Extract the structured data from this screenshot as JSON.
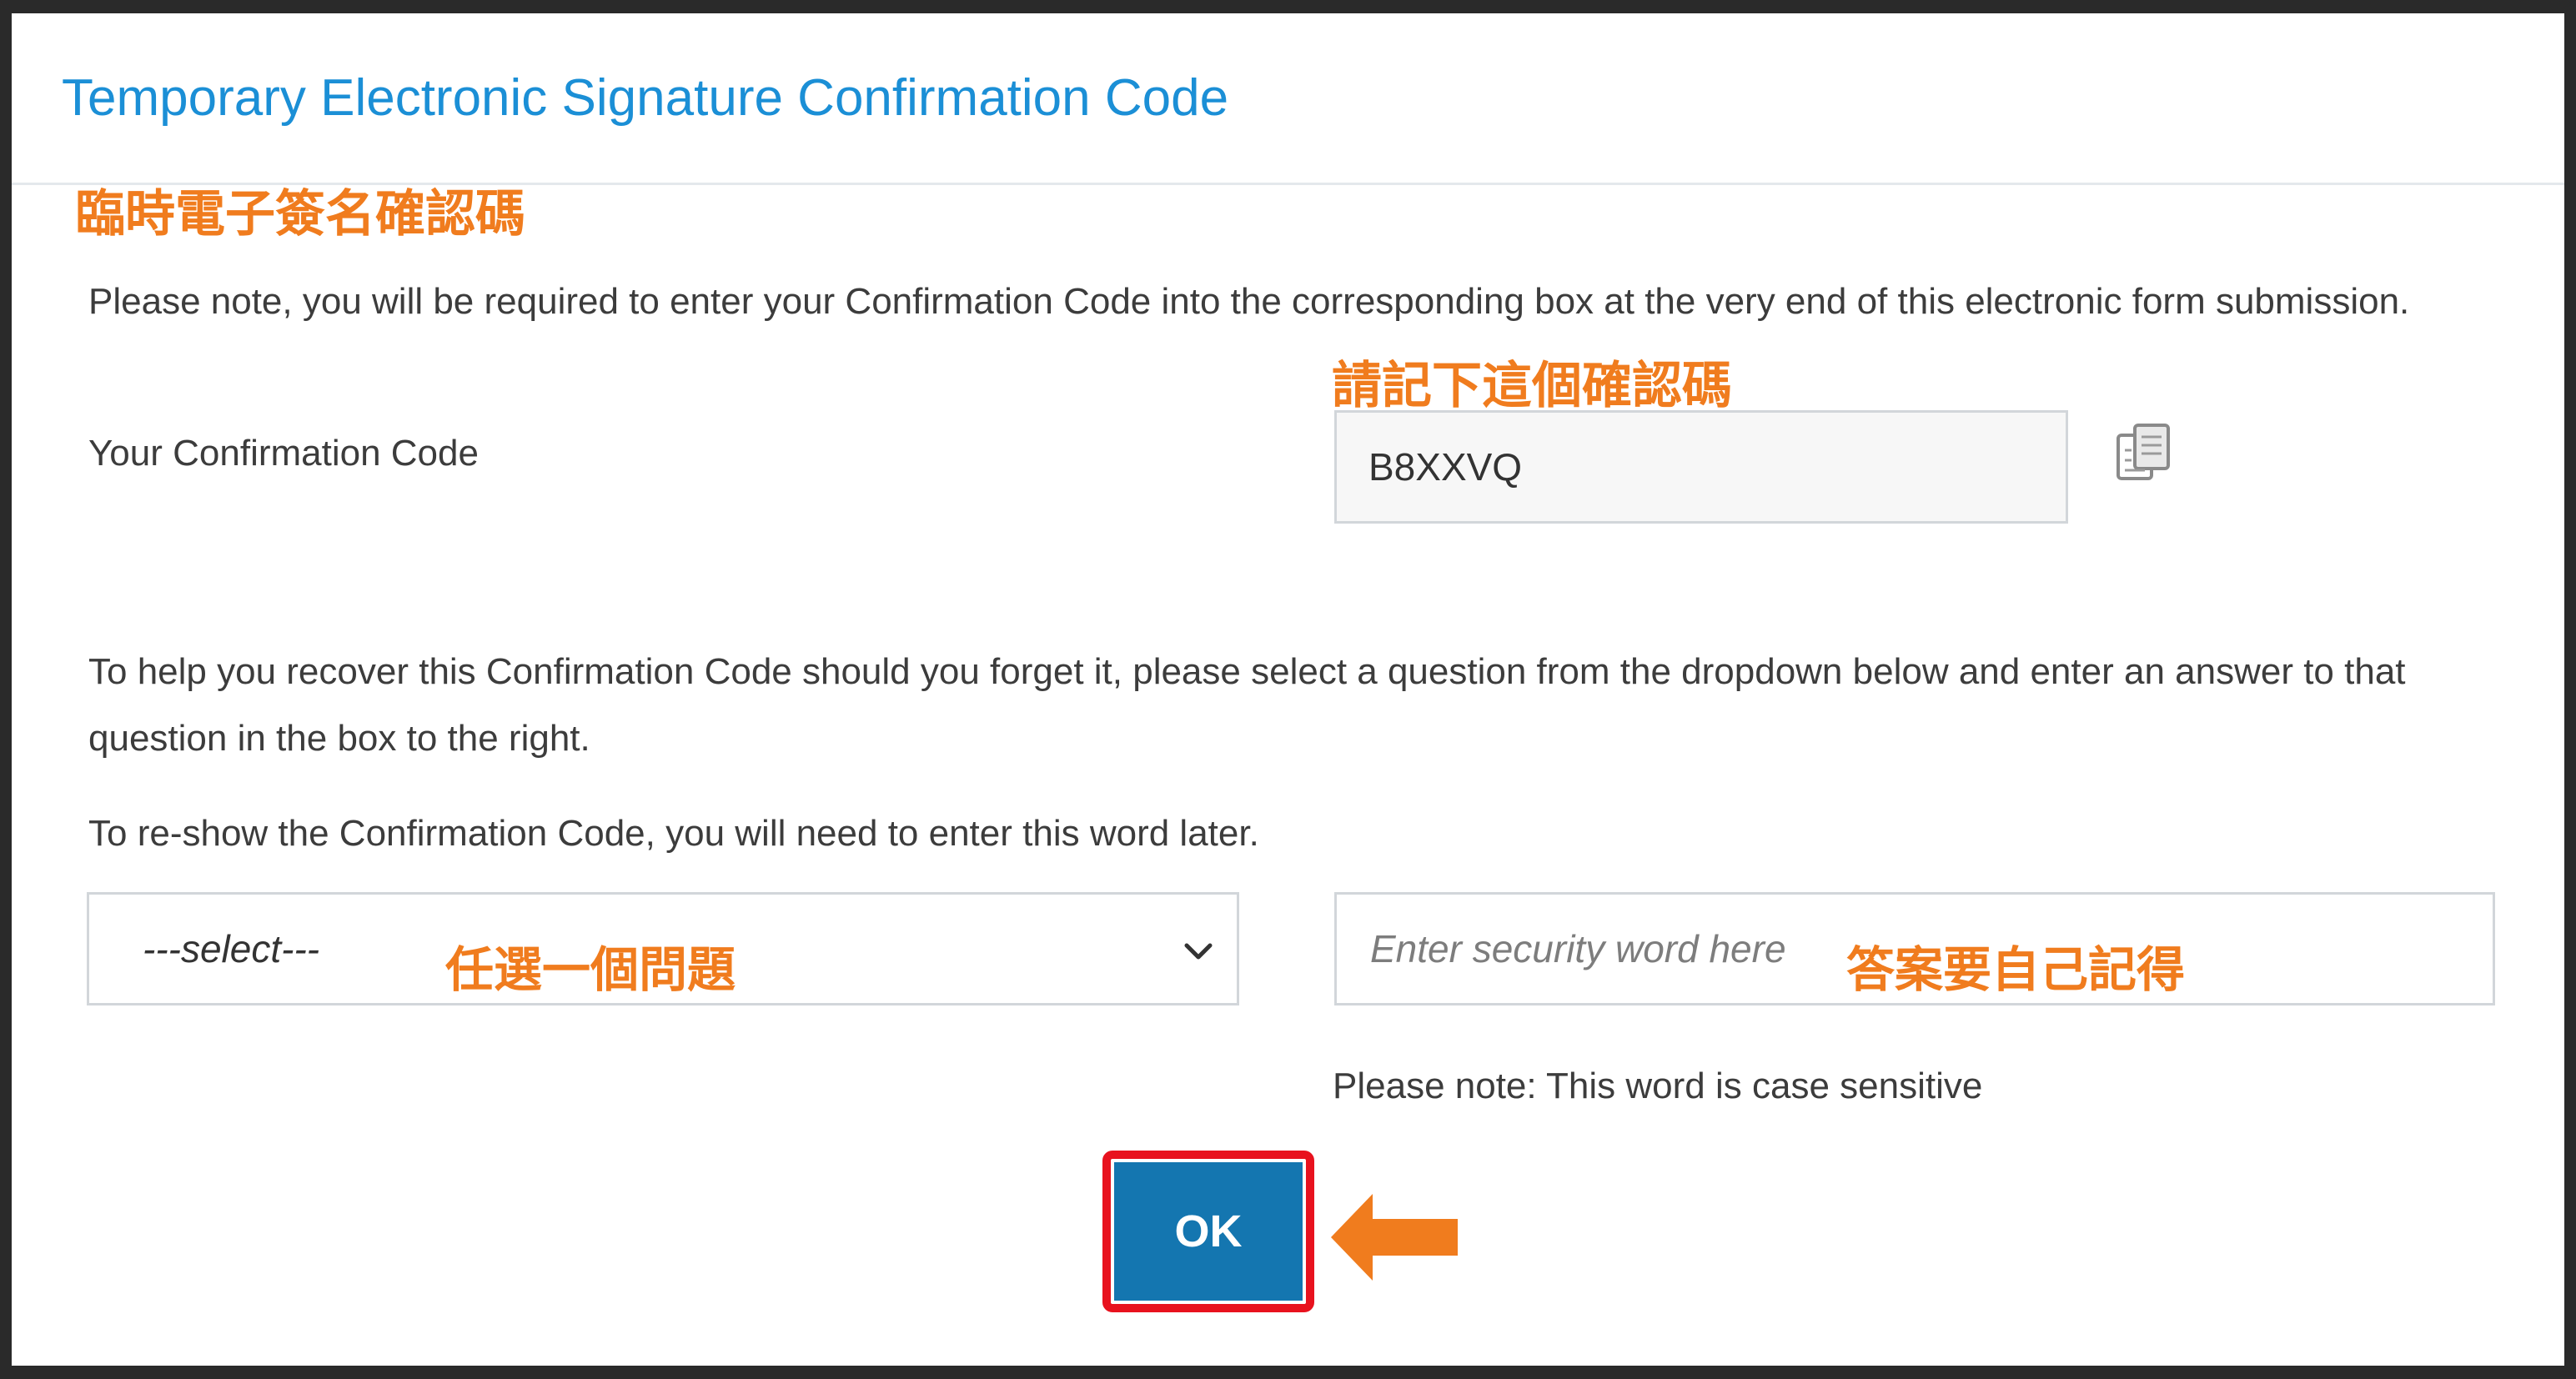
{
  "dialog": {
    "title": "Temporary Electronic Signature Confirmation Code",
    "annotations": {
      "title_zh": "臨時電子簽名確認碼",
      "code_zh": "請記下這個確認碼",
      "select_zh": "任選一個問題",
      "answer_zh": "答案要自己記得"
    },
    "note": "Please note, you will be required to enter your Confirmation Code into the corresponding box at the very end of this electronic form submission.",
    "code_label": "Your Confirmation Code",
    "code_value": "B8XXVQ",
    "copy_icon": "copy-icon",
    "help_text": "To help you recover this Confirmation Code should you forget it, please select a question from the dropdown below and enter an answer to that question in the box to the right.",
    "reshow_text": "To re-show the Confirmation Code, you will need to enter this word later.",
    "select": {
      "selected": "---select---"
    },
    "answer": {
      "placeholder": "Enter security word here",
      "value": ""
    },
    "case_note": "Please note: This word is case sensitive",
    "ok_label": "OK"
  },
  "colors": {
    "title": "#1b8fd6",
    "annotation": "#f07c1e",
    "ok_button": "#1476b0",
    "highlight": "#e8121e"
  }
}
